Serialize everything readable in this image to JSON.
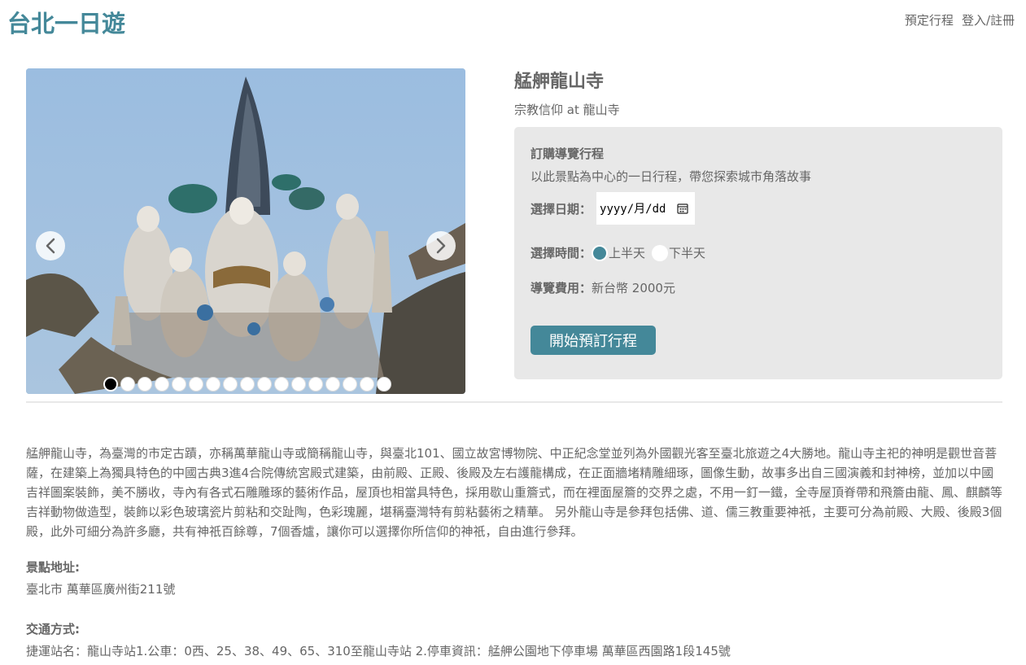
{
  "header": {
    "logo": "台北一日遊",
    "nav_schedule": "預定行程",
    "nav_login": "登入/註冊"
  },
  "attraction": {
    "name": "艋舺龍山寺",
    "category_line": "宗教信仰 at 龍山寺"
  },
  "carousel": {
    "image_count": 17,
    "active_index": 0
  },
  "booking": {
    "heading": "訂購導覽行程",
    "description": "以此景點為中心的一日行程，帶您探索城市角落故事",
    "date_label": "選擇日期：",
    "date_placeholder": "yyyy/月/dd",
    "time_label": "選擇時間：",
    "time_morning": "上半天",
    "time_afternoon": "下半天",
    "time_selected": "morning",
    "fee_label": "導覽費用：",
    "fee_value": "新台幣 2000元",
    "submit_label": "開始預訂行程"
  },
  "details": {
    "description": "艋舺龍山寺，為臺灣的市定古蹟，亦稱萬華龍山寺或簡稱龍山寺，與臺北101、國立故宮博物院、中正紀念堂並列為外國觀光客至臺北旅遊之4大勝地。龍山寺主祀的神明是觀世音菩薩，在建築上為獨具特色的中國古典3進4合院傳統宮殿式建築，由前殿、正殿、後殿及左右護龍構成，在正面牆堵精雕細琢，圖像生動，故事多出自三國演義和封神榜，並加以中國吉祥圖案裝飾，美不勝收，寺內有各式石雕雕琢的藝術作品，屋頂也相當具特色，採用歇山重簷式，而在裡面屋簷的交界之處，不用一釘一鐵，全寺屋頂脊帶和飛簷由龍、鳳、麒麟等吉祥動物做造型，裝飾以彩色玻璃瓷片剪粘和交趾陶，色彩瑰麗，堪稱臺灣特有剪粘藝術之精華。 另外龍山寺是參拜包括佛、道、儒三教重要神祇，主要可分為前殿、大殿、後殿3個殿，此外可細分為許多廳，共有神祇百餘尊，7個香爐，讓你可以選擇你所信仰的神祇，自由進行參拜。",
    "address_label": "景點地址:",
    "address_value": "臺北市 萬華區廣州街211號",
    "transport_label": "交通方式:",
    "transport_value": "捷運站名：龍山寺站1.公車：0西、25、38、49、65、310至龍山寺站 2.停車資訊：艋舺公園地下停車場 萬華區西園路1段145號"
  },
  "colors": {
    "accent": "#448899",
    "panel_bg": "#e8e8e8",
    "text": "#666666"
  }
}
